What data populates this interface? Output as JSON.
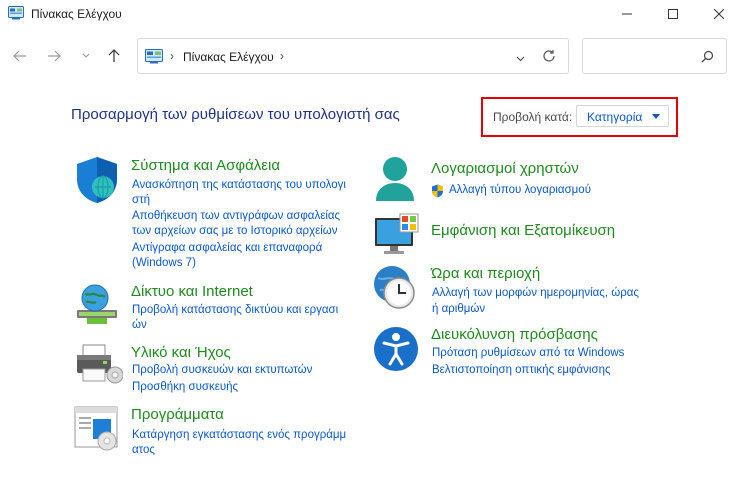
{
  "window": {
    "title": "Πίνακας Ελέγχου"
  },
  "address": {
    "path": "Πίνακας Ελέγχου",
    "search_placeholder": ""
  },
  "header": {
    "heading": "Προσαρμογή των ρυθμίσεων του υπολογιστή σας",
    "view_by_label": "Προβολή κατά:",
    "view_by_value": "Κατηγορία"
  },
  "categories": {
    "system": {
      "title": "Σύστημα και Ασφάλεια",
      "links": [
        "Ανασκόπηση της κατάστασης του υπολογι",
        "στή",
        "Αποθήκευση των αντιγράφων ασφαλείας",
        "των αρχείων σας με το Ιστορικό αρχείων",
        "Αντίγραφα ασφαλείας και επαναφορά",
        "(Windows 7)"
      ]
    },
    "network": {
      "title": "Δίκτυο και Internet",
      "links": [
        "Προβολή κατάστασης δικτύου και εργασι",
        "ών"
      ]
    },
    "hardware": {
      "title": "Υλικό και Ήχος",
      "links": [
        "Προβολή συσκευών και εκτυπωτών",
        "Προσθήκη συσκευής"
      ]
    },
    "programs": {
      "title": "Προγράμματα",
      "links": [
        "Κατάργηση εγκατάστασης ενός προγράμμ",
        "ατος"
      ]
    },
    "accounts": {
      "title": "Λογαριασμοί χρηστών",
      "links": [
        "Αλλαγή τύπου λογαριασμού"
      ]
    },
    "appearance": {
      "title": "Εμφάνιση και Εξατομίκευση",
      "links": []
    },
    "clock": {
      "title": "Ώρα και περιοχή",
      "links": [
        "Αλλαγή των μορφών ημερομηνίας, ώρας",
        "ή αριθμών"
      ]
    },
    "access": {
      "title": "Διευκόλυνση πρόσβασης",
      "links": [
        "Πρόταση ρυθμίσεων από τα Windows",
        "Βελτιστοποίηση οπτικής εμφάνισης"
      ]
    }
  },
  "colors": {
    "category_title": "#1e8b1e",
    "link": "#0a58ca",
    "heading": "#1e3287",
    "highlight_box": "#e60000"
  },
  "icons": {
    "system": "shield-icon",
    "network": "network-globe-icon",
    "hardware": "printer-icon",
    "programs": "programs-icon",
    "accounts": "user-icon",
    "appearance": "monitor-icon",
    "clock": "clock-globe-icon",
    "access": "accessibility-icon"
  }
}
